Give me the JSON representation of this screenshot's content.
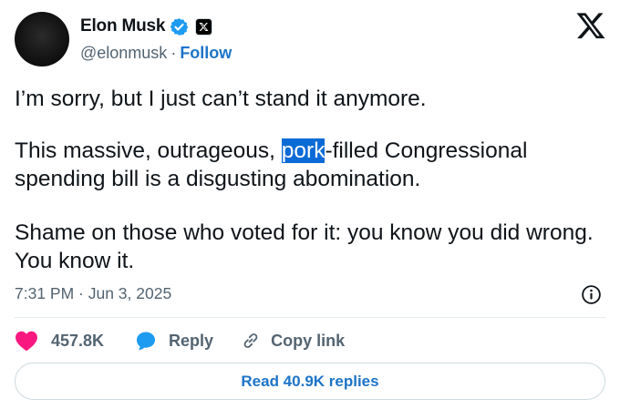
{
  "author": {
    "name": "Elon Musk",
    "handle": "@elonmusk",
    "separator": "·",
    "follow_label": "Follow"
  },
  "tweet": {
    "para1": "I’m sorry, but I just can’t stand it anymore.",
    "para2_before": "This massive, outrageous, ",
    "para2_highlight": "pork",
    "para2_after": "-filled Congressional spending bill is a disgusting abomination.",
    "para3": "Shame on those who voted for it: you know you did wrong. You know it.",
    "timestamp": "7:31 PM · Jun 3, 2025"
  },
  "actions": {
    "like_count": "457.8K",
    "reply_label": "Reply",
    "copy_link_label": "Copy link"
  },
  "read_replies_label": "Read 40.9K replies",
  "colors": {
    "link_blue": "#1d74c8",
    "like_red": "#f91880",
    "reply_blue": "#1d9bf0",
    "highlight": "#0a6bd6",
    "muted": "#536471"
  },
  "icons": [
    "verified-badge-icon",
    "x-badge-icon",
    "x-logo-icon",
    "info-icon",
    "heart-icon",
    "reply-bubble-icon",
    "link-icon"
  ]
}
